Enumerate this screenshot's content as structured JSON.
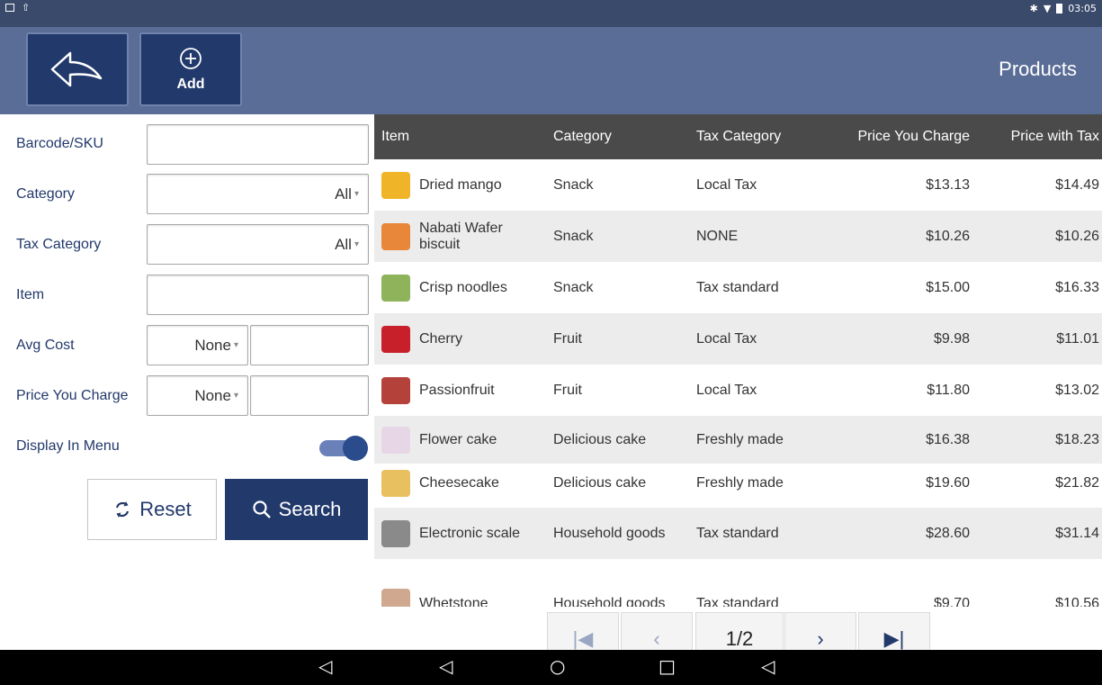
{
  "status_bar": {
    "time": "03:05"
  },
  "header": {
    "add_label": "Add",
    "title": "Products"
  },
  "filters": {
    "barcode_label": "Barcode/SKU",
    "category_label": "Category",
    "category_value": "All",
    "tax_category_label": "Tax Category",
    "tax_category_value": "All",
    "item_label": "Item",
    "avg_cost_label": "Avg Cost",
    "avg_cost_op": "None",
    "price_label": "Price You Charge",
    "price_op": "None",
    "display_menu_label": "Display In Menu",
    "display_menu_on": true,
    "reset_label": "Reset",
    "search_label": "Search"
  },
  "table": {
    "headers": [
      "Item",
      "Category",
      "Tax Category",
      "Price You Charge",
      "Price with Tax"
    ],
    "rows": [
      {
        "item": "Dried mango",
        "category": "Snack",
        "tax": "Local Tax",
        "price": "$13.13",
        "price_tax": "$14.49",
        "thumb_color": "#f0b428"
      },
      {
        "item": "Nabati Wafer biscuit",
        "category": "Snack",
        "tax": "NONE",
        "price": "$10.26",
        "price_tax": "$10.26",
        "thumb_color": "#e8873a"
      },
      {
        "item": "Crisp noodles",
        "category": "Snack",
        "tax": "Tax standard",
        "price": "$15.00",
        "price_tax": "$16.33",
        "thumb_color": "#8fb35a"
      },
      {
        "item": "Cherry",
        "category": "Fruit",
        "tax": "Local Tax",
        "price": "$9.98",
        "price_tax": "$11.01",
        "thumb_color": "#c8202a"
      },
      {
        "item": "Passionfruit",
        "category": "Fruit",
        "tax": "Local Tax",
        "price": "$11.80",
        "price_tax": "$13.02",
        "thumb_color": "#b5423a"
      },
      {
        "item": "Flower cake",
        "category": "Delicious cake",
        "tax": "Freshly made",
        "price": "$16.38",
        "price_tax": "$18.23",
        "thumb_color": "#e6d6e6"
      },
      {
        "item": "Cheesecake",
        "category": "Delicious cake",
        "tax": "Freshly made",
        "price": "$19.60",
        "price_tax": "$21.82",
        "thumb_color": "#e8c060"
      },
      {
        "item": "Electronic scale",
        "category": "Household goods",
        "tax": "Tax standard",
        "price": "$28.60",
        "price_tax": "$31.14",
        "thumb_color": "#8a8a8a"
      },
      {
        "item": "Whetstone",
        "category": "Household goods",
        "tax": "Tax standard",
        "price": "$9.70",
        "price_tax": "$10.56",
        "thumb_color": "#d0a890"
      }
    ]
  },
  "pagination": {
    "page": "1/2"
  }
}
